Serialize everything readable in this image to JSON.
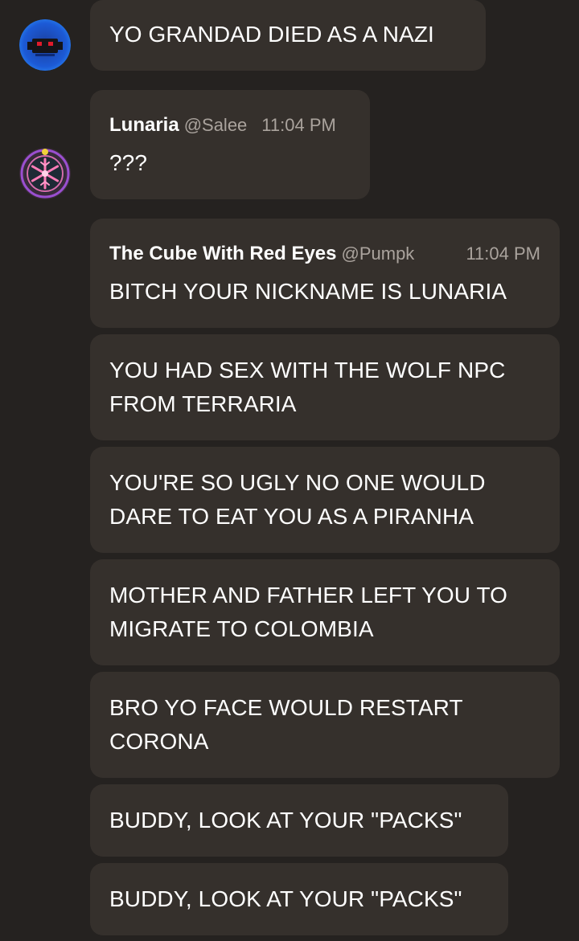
{
  "messages": [
    {
      "text": "YO GRANDAD DIED AS A NAZI"
    },
    {
      "author": "Lunaria",
      "handle": "@Salee",
      "time": "11:04 PM",
      "text": "???"
    },
    {
      "author": "The Cube With Red Eyes",
      "handle": "@Pumpk",
      "time": "11:04 PM",
      "text": "BITCH YOUR NICKNAME IS LUNARIA"
    },
    {
      "text": "YOU HAD SEX WITH THE WOLF NPC FROM TERRARIA"
    },
    {
      "text": "YOU'RE SO UGLY NO ONE WOULD DARE TO EAT YOU AS A PIRANHA"
    },
    {
      "text": "MOTHER AND FATHER LEFT YOU TO MIGRATE TO COLOMBIA"
    },
    {
      "text": "BRO YO FACE WOULD RESTART CORONA"
    },
    {
      "text": "BUDDY, LOOK AT YOUR \"PACKS\""
    },
    {
      "text": "BUDDY, LOOK AT YOUR \"PACKS\""
    }
  ],
  "colors": {
    "background": "#252220",
    "bubble": "#35302c",
    "text": "#ffffff",
    "muted": "#aaa39d"
  },
  "icons": {
    "avatar_1": "red-eyed-cube-avatar",
    "avatar_2": "lunaria-snowflake-avatar"
  }
}
